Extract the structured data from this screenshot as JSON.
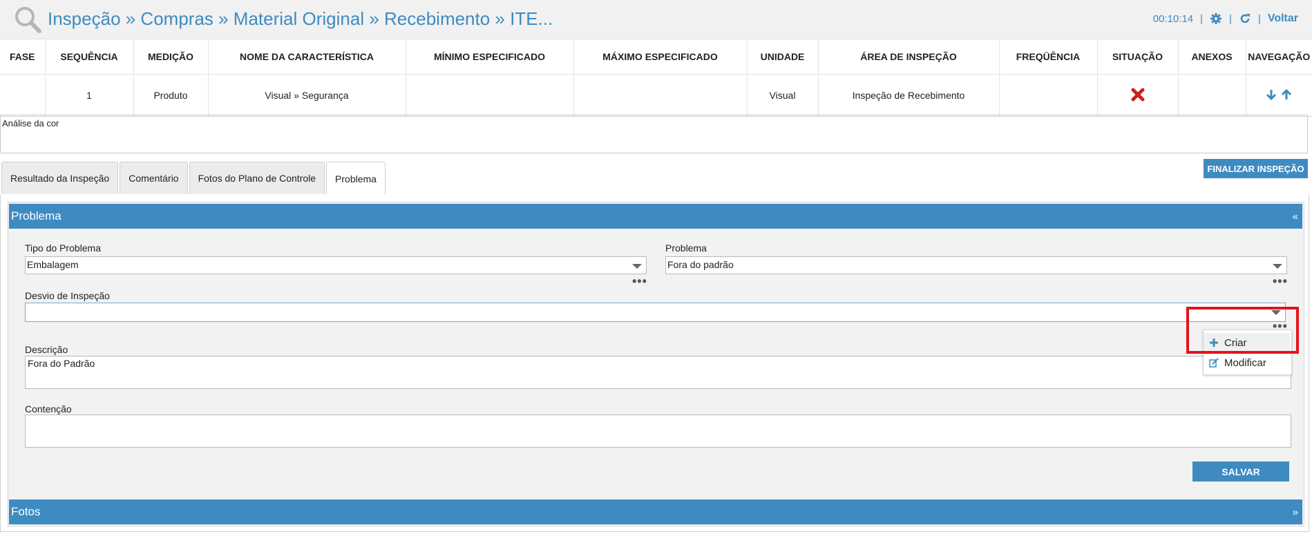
{
  "header": {
    "breadcrumb": "Inspeção » Compras » Material Original » Recebimento » ITE...",
    "timer": "00:10:14",
    "sep": "|",
    "back_label": "Voltar"
  },
  "table": {
    "columns": [
      "FASE",
      "SEQUÊNCIA",
      "MEDIÇÃO",
      "NOME DA CARACTERÍSTICA",
      "MÍNIMO ESPECIFICADO",
      "MÁXIMO ESPECIFICADO",
      "UNIDADE",
      "ÁREA DE INSPEÇÃO",
      "FREQÜÊNCIA",
      "SITUAÇÃO",
      "ANEXOS",
      "NAVEGAÇÃO"
    ],
    "row": {
      "fase": "",
      "sequencia": "1",
      "medicao": "Produto",
      "nome": "Visual » Segurança",
      "minimo": "",
      "maximo": "",
      "unidade": "Visual",
      "area": "Inspeção de Recebimento",
      "frequencia": "",
      "situacao_icon": "red-x-icon",
      "anexos": ""
    }
  },
  "analysis_note": "Análise da cor",
  "tabs": [
    "Resultado da Inspeção",
    "Comentário",
    "Fotos do Plano de Controle",
    "Problema"
  ],
  "active_tab": "Problema",
  "finalize_label": "FINALIZAR INSPEÇÃO",
  "problem_panel": {
    "title": "Problema",
    "collapse_glyph": "«",
    "tipo_label": "Tipo do Problema",
    "tipo_value": "Embalagem",
    "problema_label": "Problema",
    "problema_value": "Fora do padrão",
    "desvio_label": "Desvio de Inspeção",
    "desvio_value": "",
    "descricao_label": "Descrição",
    "descricao_value": "Fora do Padrão",
    "contencao_label": "Contenção",
    "contencao_value": "",
    "save_label": "SALVAR",
    "more_glyph": "•••"
  },
  "context_menu": {
    "items": [
      {
        "label": "Criar",
        "icon": "plus-icon"
      },
      {
        "label": "Modificar",
        "icon": "edit-icon"
      }
    ]
  },
  "photos_panel": {
    "title": "Fotos",
    "expand_glyph": "»"
  },
  "colors": {
    "accent": "#3d8bc1",
    "highlight": "#e3131b"
  }
}
